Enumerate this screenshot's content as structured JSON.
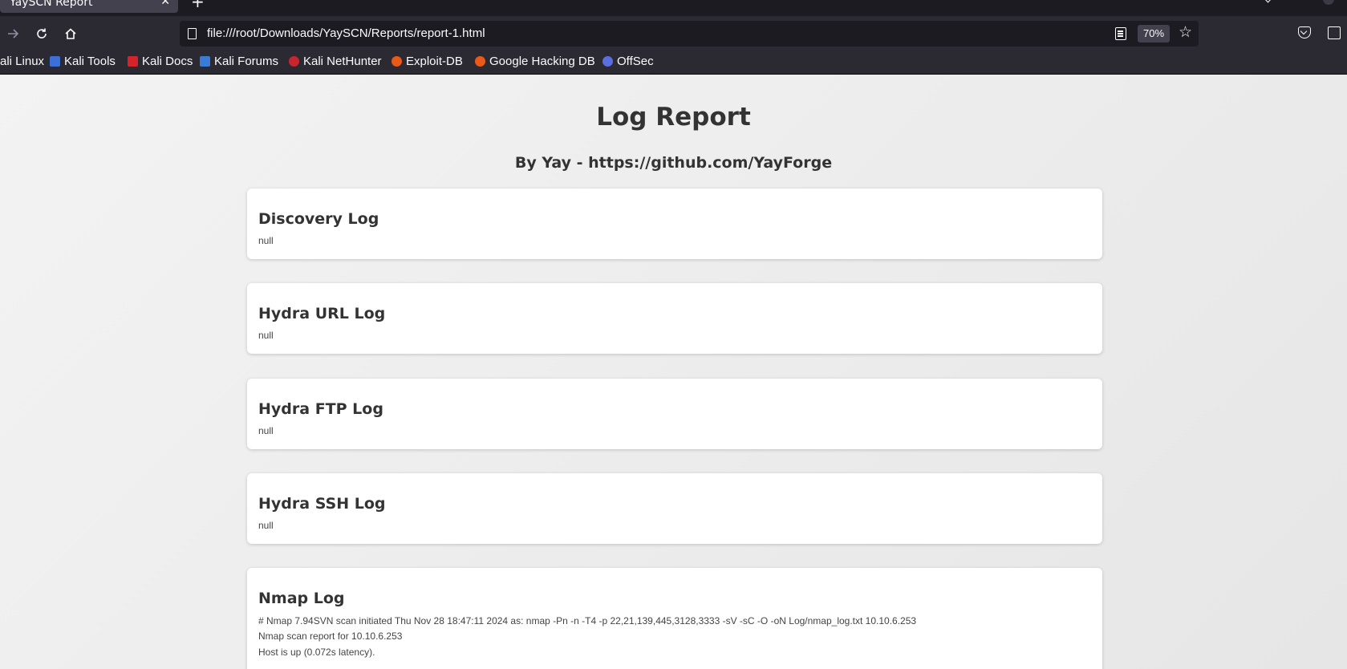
{
  "browser": {
    "tab_title": "YaySCN Report",
    "tab_close": "✕",
    "new_tab": "+",
    "url": "file:///root/Downloads/YaySCN/Reports/report-1.html",
    "zoom_level": "70%",
    "bookmarks": [
      "ali Linux",
      "Kali Tools",
      "Kali Docs",
      "Kali Forums",
      "Kali NetHunter",
      "Exploit-DB",
      "Google Hacking DB",
      "OffSec"
    ],
    "icons": {
      "back": "arrow-left-icon",
      "forward": "arrow-right-icon",
      "reload": "reload-icon",
      "home": "home-icon",
      "reader": "reader-view-icon",
      "bookmark": "star-icon",
      "pocket": "pocket-icon",
      "extensions": "extensions-icon"
    }
  },
  "report": {
    "title": "Log Report",
    "subtitle": "By Yay - https://github.com/YayForge",
    "sections": [
      {
        "title": "Discovery Log",
        "content": "null"
      },
      {
        "title": "Hydra URL Log",
        "content": "null"
      },
      {
        "title": "Hydra FTP Log",
        "content": "null"
      },
      {
        "title": "Hydra SSH Log",
        "content": "null"
      }
    ],
    "nmap": {
      "title": "Nmap Log",
      "lines": [
        "# Nmap 7.94SVN scan initiated Thu Nov 28 18:47:11 2024 as: nmap -Pn -n -T4 -p 22,21,139,445,3128,3333 -sV -sC -O -oN Log/nmap_log.txt 10.10.6.253",
        "Nmap scan report for 10.10.6.253",
        "Host is up (0.072s latency)."
      ]
    }
  },
  "colors": {
    "chrome_dark": "#1c1b22",
    "chrome": "#2b2a33",
    "page_bg": "#ececec",
    "card_bg": "#ffffff",
    "heading_text": "#333333"
  }
}
